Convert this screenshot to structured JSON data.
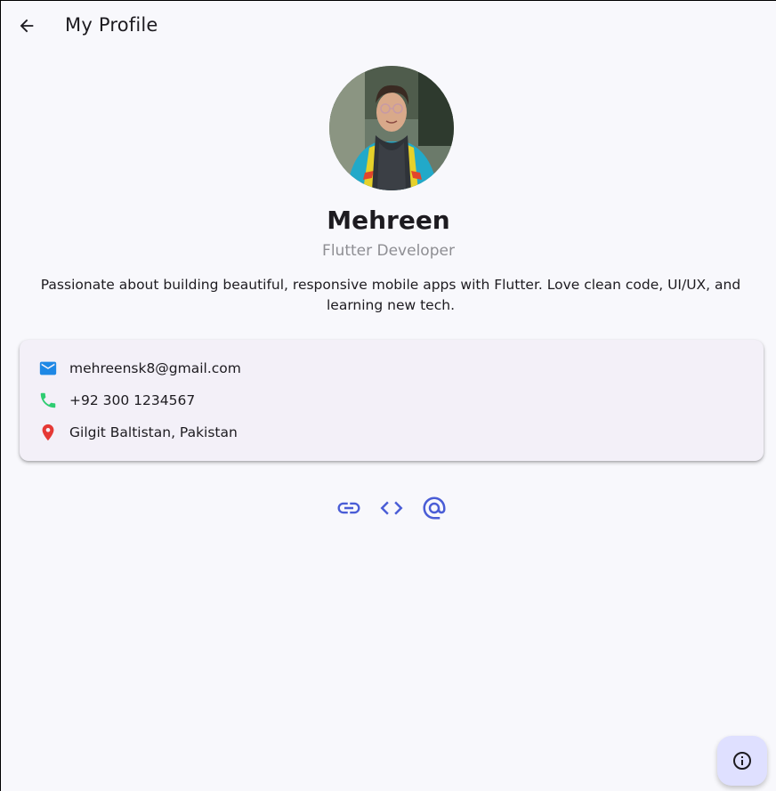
{
  "appbar": {
    "back_icon": "arrow-back-icon",
    "title": "My Profile"
  },
  "profile": {
    "name": "Mehreen",
    "role": "Flutter Developer",
    "bio": "Passionate about building beautiful, responsive mobile apps with Flutter. Love clean code, UI/UX, and learning new tech."
  },
  "contact": {
    "email": {
      "icon": "email-icon",
      "value": "mehreensk8@gmail.com",
      "color": "#1e88e5"
    },
    "phone": {
      "icon": "phone-icon",
      "value": "+92 300 1234567",
      "color": "#2ecc71"
    },
    "location": {
      "icon": "location-pin-icon",
      "value": "Gilgit Baltistan, Pakistan",
      "color": "#e53935"
    }
  },
  "socials": [
    {
      "icon": "link-icon"
    },
    {
      "icon": "code-icon"
    },
    {
      "icon": "at-icon"
    }
  ],
  "fab": {
    "icon": "info-icon"
  },
  "colors": {
    "accent": "#4a5dd6",
    "background": "#f8f8fc",
    "card": "#f3f0f8",
    "fab": "#dfe0ff"
  }
}
